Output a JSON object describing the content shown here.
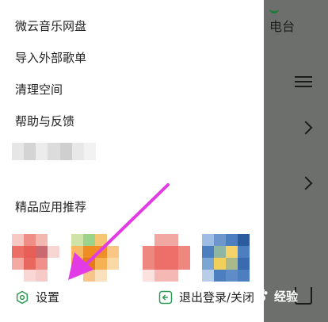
{
  "background": {
    "tab_label": "电台",
    "colors": {
      "dim": "#6c6f6c",
      "accent_green": "#1a7b3a"
    }
  },
  "menu": {
    "items": [
      {
        "label": "微云音乐网盘"
      },
      {
        "label": "导入外部歌单"
      },
      {
        "label": "清理空间"
      },
      {
        "label": "帮助与反馈"
      }
    ]
  },
  "recommended": {
    "title": "精品应用推荐"
  },
  "footer": {
    "settings_label": "设置",
    "logout_label": "退出登录/关闭"
  },
  "watermark": {
    "text": "经验"
  },
  "colors": {
    "arrow": "#e23be6",
    "icon_green": "#2c9a52"
  }
}
